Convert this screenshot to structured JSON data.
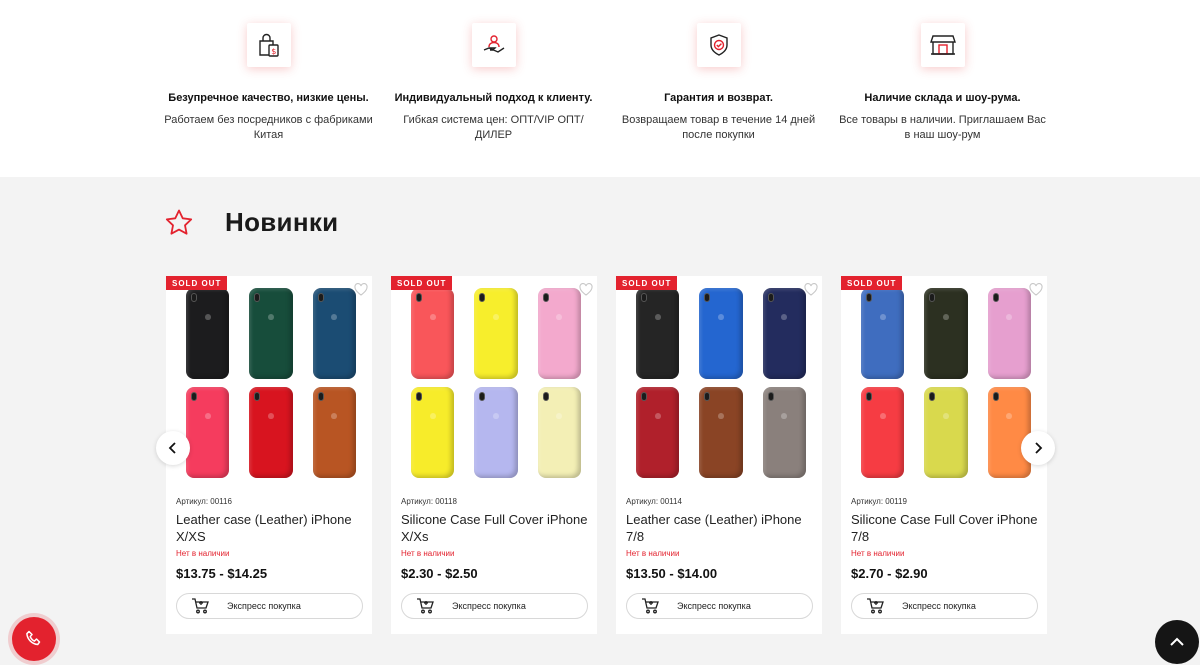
{
  "colors": {
    "accent": "#e3222e",
    "section_bg": "#f3f3f3"
  },
  "features": [
    {
      "icon": "shopping-bag-icon",
      "title": "Безупречное качество, низкие цены.",
      "text": "Работаем без посредников с фабриками Китая"
    },
    {
      "icon": "hand-user-icon",
      "title": "Индивидуальный подход к клиенту.",
      "text": "Гибкая система цен: ОПТ/VIP ОПТ/ДИЛЕР"
    },
    {
      "icon": "shield-check-icon",
      "title": "Гарантия и возврат.",
      "text": "Возвращаем товар в течение 14 дней после покупки"
    },
    {
      "icon": "store-icon",
      "title": "Наличие склада и шоу-рума.",
      "text": "Все товары в наличии. Приглашаем Вас в наш шоу-рум"
    }
  ],
  "section": {
    "icon": "star-icon",
    "title": "Новинки"
  },
  "products": [
    {
      "badge": "SOLD OUT",
      "sku": "Артикул: 00116",
      "name": "Leather case (Leather) iPhone X/XS",
      "stock": "Нет в наличии",
      "price": "$13.75 - $14.25",
      "button": "Экспресс покупка",
      "swatches": [
        "#1c1c1e",
        "#174d3b",
        "#1b4c73",
        "#f53c5e",
        "#d8141f",
        "#b85523"
      ]
    },
    {
      "badge": "SOLD OUT",
      "sku": "Артикул: 00118",
      "name": "Silicone Case Full Cover iPhone X/Xs",
      "stock": "Нет в наличии",
      "price": "$2.30 - $2.50",
      "button": "Экспресс покупка",
      "swatches": [
        "#f9565a",
        "#f7ee2c",
        "#f3a9cd",
        "#f7ec2a",
        "#b5b7ef",
        "#f3efb5"
      ]
    },
    {
      "badge": "SOLD OUT",
      "sku": "Артикул: 00114",
      "name": "Leather case (Leather) iPhone 7/8",
      "stock": "Нет в наличии",
      "price": "$13.50 - $14.00",
      "button": "Экспресс покупка",
      "swatches": [
        "#252525",
        "#2466d0",
        "#232c5e",
        "#b0202b",
        "#8a4425",
        "#8a807c"
      ]
    },
    {
      "badge": "SOLD OUT",
      "sku": "Артикул: 00119",
      "name": "Silicone Case Full Cover iPhone 7/8",
      "stock": "Нет в наличии",
      "price": "$2.70 - $2.90",
      "button": "Экспресс покупка",
      "swatches": [
        "#3f6dbf",
        "#2c3021",
        "#e69fcf",
        "#f63c43",
        "#d9d94d",
        "#ff8a45"
      ]
    }
  ],
  "controls": {
    "prev": "chevron-left-icon",
    "next": "chevron-right-icon",
    "call": "phone-icon",
    "top": "chevron-up-icon"
  }
}
